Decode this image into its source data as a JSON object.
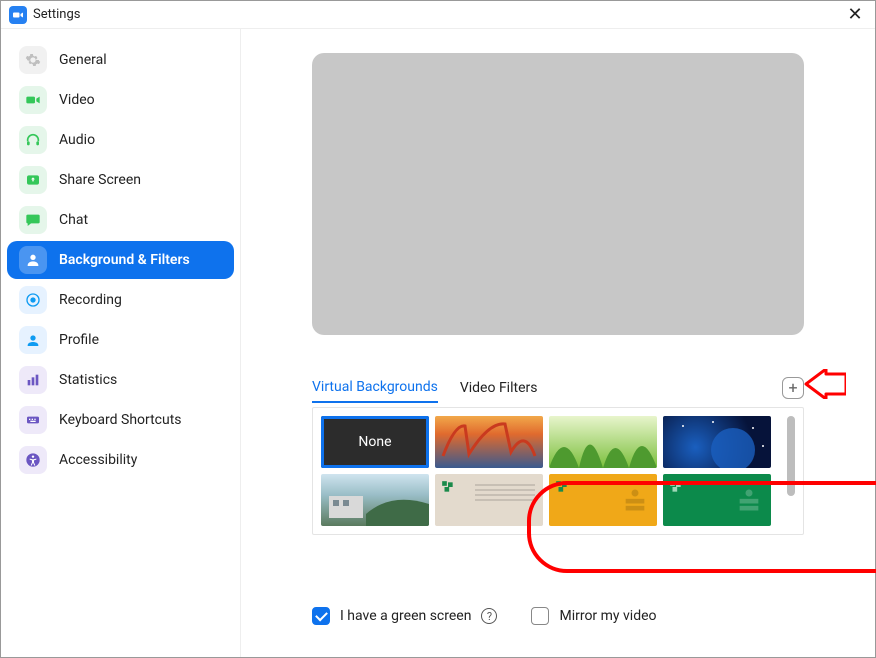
{
  "window": {
    "title": "Settings"
  },
  "sidebar": {
    "items": [
      {
        "label": "General"
      },
      {
        "label": "Video"
      },
      {
        "label": "Audio"
      },
      {
        "label": "Share Screen"
      },
      {
        "label": "Chat"
      },
      {
        "label": "Background & Filters"
      },
      {
        "label": "Recording"
      },
      {
        "label": "Profile"
      },
      {
        "label": "Statistics"
      },
      {
        "label": "Keyboard Shortcuts"
      },
      {
        "label": "Accessibility"
      }
    ]
  },
  "tabs": {
    "virtual_backgrounds": "Virtual Backgrounds",
    "video_filters": "Video Filters"
  },
  "thumbs": {
    "none_label": "None"
  },
  "bottom": {
    "green_screen_label": "I have a green screen",
    "mirror_label": "Mirror my video"
  }
}
